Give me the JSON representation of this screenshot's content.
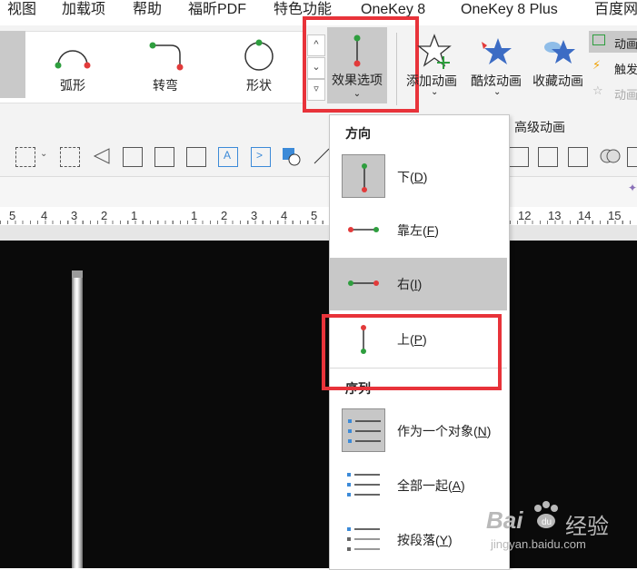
{
  "menubar": {
    "items": [
      "视图",
      "加载项",
      "帮助",
      "福昕PDF",
      "特色功能",
      "OneKey 8",
      "OneKey 8 Plus",
      "百度网"
    ]
  },
  "ribbon": {
    "gallery": [
      {
        "label": "弧形",
        "icon": "arc-path-icon"
      },
      {
        "label": "转弯",
        "icon": "turn-path-icon"
      },
      {
        "label": "形状",
        "icon": "shape-path-icon"
      }
    ],
    "effect_options": {
      "label": "效果选项",
      "chevron": "⌄"
    },
    "add_animation": {
      "label": "添加动画",
      "chevron": "⌄"
    },
    "cool_animation": {
      "label": "酷炫动画",
      "chevron": "⌄"
    },
    "fav_animation": {
      "label": "收藏动画"
    },
    "right_items": [
      "动画",
      "触发",
      "动画"
    ],
    "advanced_label": "高级动画"
  },
  "ruler": {
    "numbers": [
      "5",
      "4",
      "3",
      "2",
      "1",
      "1",
      "2",
      "3",
      "4",
      "5",
      "12",
      "13",
      "14",
      "15"
    ]
  },
  "dropdown": {
    "direction_header": "方向",
    "sequence_header": "序列",
    "direction_items": [
      {
        "text": "下",
        "key": "D",
        "icon": "vertical-down-icon",
        "selected": false,
        "boxed": true
      },
      {
        "text": "靠左",
        "key": "F",
        "icon": "horizontal-left-icon",
        "selected": false,
        "boxed": false
      },
      {
        "text": "右",
        "key": "I",
        "icon": "horizontal-right-icon",
        "selected": true,
        "boxed": false
      },
      {
        "text": "上",
        "key": "P",
        "icon": "vertical-up-icon",
        "selected": false,
        "boxed": false
      }
    ],
    "sequence_items": [
      {
        "text": "作为一个对象",
        "key": "N",
        "icon": "as-one-object-icon",
        "boxed": true
      },
      {
        "text": "全部一起",
        "key": "A",
        "icon": "all-at-once-icon",
        "boxed": false
      },
      {
        "text": "按段落",
        "key": "Y",
        "icon": "by-paragraph-icon",
        "boxed": false
      }
    ]
  },
  "watermark": {
    "brand": "Bai",
    "suffix": "经验",
    "url": "jingyan.baidu.com"
  },
  "colors": {
    "highlight_red": "#e8333a",
    "path_green": "#2e9e3e",
    "path_red": "#e23a3a",
    "star_blue": "#3c6cc4"
  }
}
